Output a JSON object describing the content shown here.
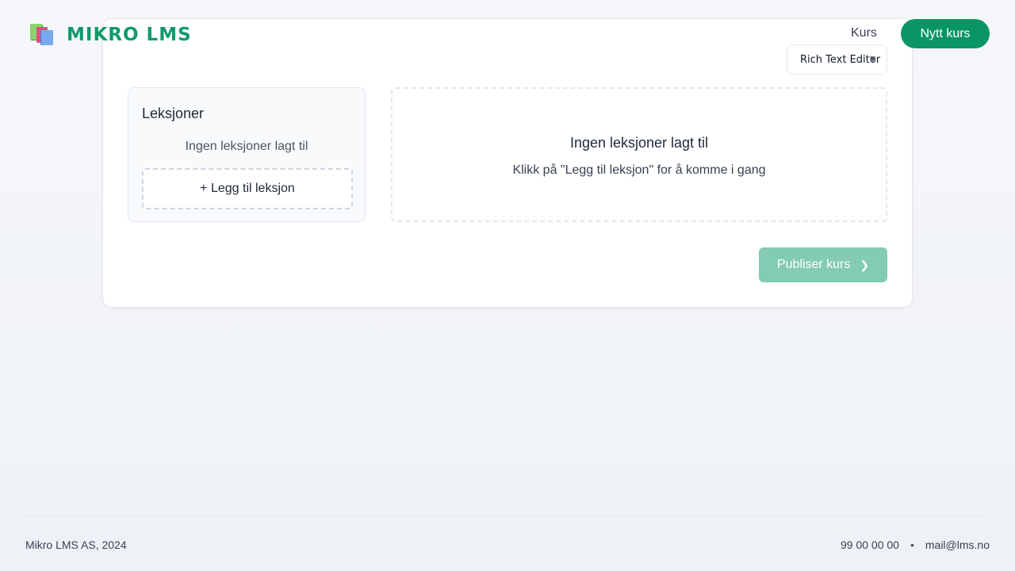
{
  "header": {
    "brand_name": "MIKRO LMS",
    "logo_icon": "books-icon",
    "nav_courses": "Kurs",
    "new_course_button": "Nytt kurs"
  },
  "editor": {
    "editor_type_selected": "Rich Text Editor"
  },
  "lessons": {
    "title": "Leksjoner",
    "empty_text": "Ingen leksjoner lagt til",
    "add_button": "+ Legg til leksjon"
  },
  "content": {
    "empty_title": "Ingen leksjoner lagt til",
    "empty_subtitle": "Klikk på \"Legg til leksjon\" for å komme i gang"
  },
  "actions": {
    "publish_button": "Publiser kurs"
  },
  "footer": {
    "company": "Mikro LMS AS, 2024",
    "phone": "99 00 00 00",
    "separator": "•",
    "email": "mail@lms.no"
  },
  "colors": {
    "brand": "#0f9a6c",
    "primary_button": "#0a9566",
    "publish_disabled": "#84cbb3"
  }
}
